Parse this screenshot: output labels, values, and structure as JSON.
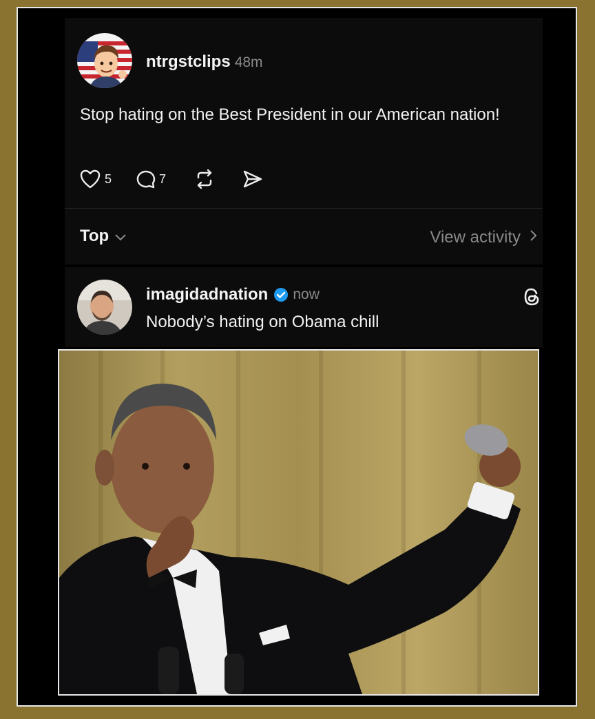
{
  "post": {
    "username": "ntrgstclips",
    "time": "48m",
    "text": "Stop hating on the Best President in our American nation!",
    "likes": "5",
    "comments": "7"
  },
  "thread_controls": {
    "sort_label": "Top",
    "view_activity_label": "View activity"
  },
  "reply": {
    "username": "imagidadnation",
    "time": "now",
    "text": "Nobody’s hating on Obama chill",
    "verified": true
  },
  "icons": {
    "like": "heart-icon",
    "comment": "comment-icon",
    "repost": "repost-icon",
    "share": "send-icon",
    "threads": "threads-logo-icon",
    "verified": "verified-badge-icon"
  },
  "colors": {
    "background": "#8a7330",
    "panel": "#0c0c0d",
    "text": "#f2f2f2",
    "muted": "#8a8a8a",
    "verified": "#1d9bf0"
  }
}
